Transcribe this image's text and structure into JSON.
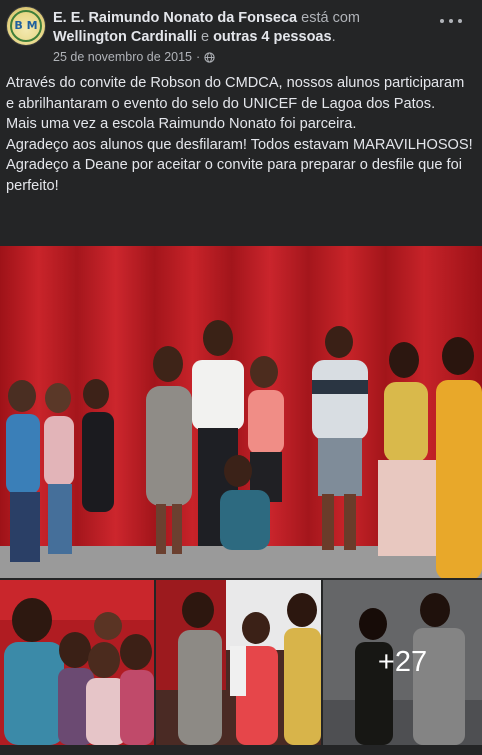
{
  "post": {
    "author": "E. E. Raimundo Nonato da Fonseca",
    "with_text": "está com",
    "tagged_primary": "Wellington Cardinalli",
    "tagged_conjunction": "e",
    "tagged_others": "outras 4 pessoas",
    "tagged_suffix": ".",
    "date": "25 de novembro de 2015",
    "separator": "·",
    "avatar_logo": "B  M",
    "paragraphs": [
      "Através do convite de Robson do CMDCA, nossos alunos participaram e abrilhantaram o evento do selo do UNICEF de Lagoa dos Patos.",
      "Mais uma vez a escola Raimundo Nonato foi parceira.",
      "Agradeço aos alunos que desfilaram! Todos estavam MARAVILHOSOS!",
      "Agradeço a Deane por aceitar o convite para preparar o desfile que foi perfeito!"
    ],
    "extra_photos_count": "+27"
  },
  "icons": {
    "more": "more-horizontal-icon",
    "privacy": "globe-icon"
  },
  "colors": {
    "background": "#242526",
    "text_primary": "#e4e6eb",
    "text_secondary": "#b0b3b8",
    "curtain_red": "#b01c22"
  }
}
